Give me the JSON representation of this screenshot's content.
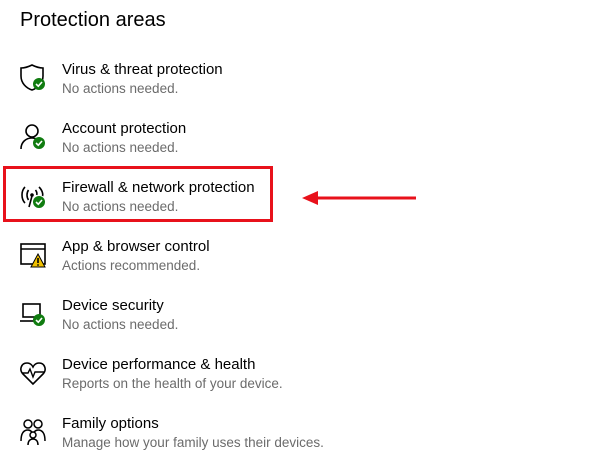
{
  "page": {
    "title": "Protection areas"
  },
  "areas": [
    {
      "label": "Virus & threat protection",
      "status": "No actions needed.",
      "icon": "shield-icon",
      "state": "ok"
    },
    {
      "label": "Account protection",
      "status": "No actions needed.",
      "icon": "person-icon",
      "state": "ok"
    },
    {
      "label": "Firewall & network protection",
      "status": "No actions needed.",
      "icon": "antenna-icon",
      "state": "ok"
    },
    {
      "label": "App & browser control",
      "status": "Actions recommended.",
      "icon": "browser-window-icon",
      "state": "warning"
    },
    {
      "label": "Device security",
      "status": "No actions needed.",
      "icon": "laptop-icon",
      "state": "ok"
    },
    {
      "label": "Device performance & health",
      "status": "Reports on the health of your device.",
      "icon": "heart-pulse-icon",
      "state": "none"
    },
    {
      "label": "Family options",
      "status": "Manage how your family uses their devices.",
      "icon": "family-icon",
      "state": "none"
    }
  ],
  "annotation": {
    "highlight_color": "#e8111b"
  },
  "colors": {
    "ok_badge": "#107c10",
    "warning_badge": "#f0c000",
    "secondary_text": "#6b6b6b"
  }
}
